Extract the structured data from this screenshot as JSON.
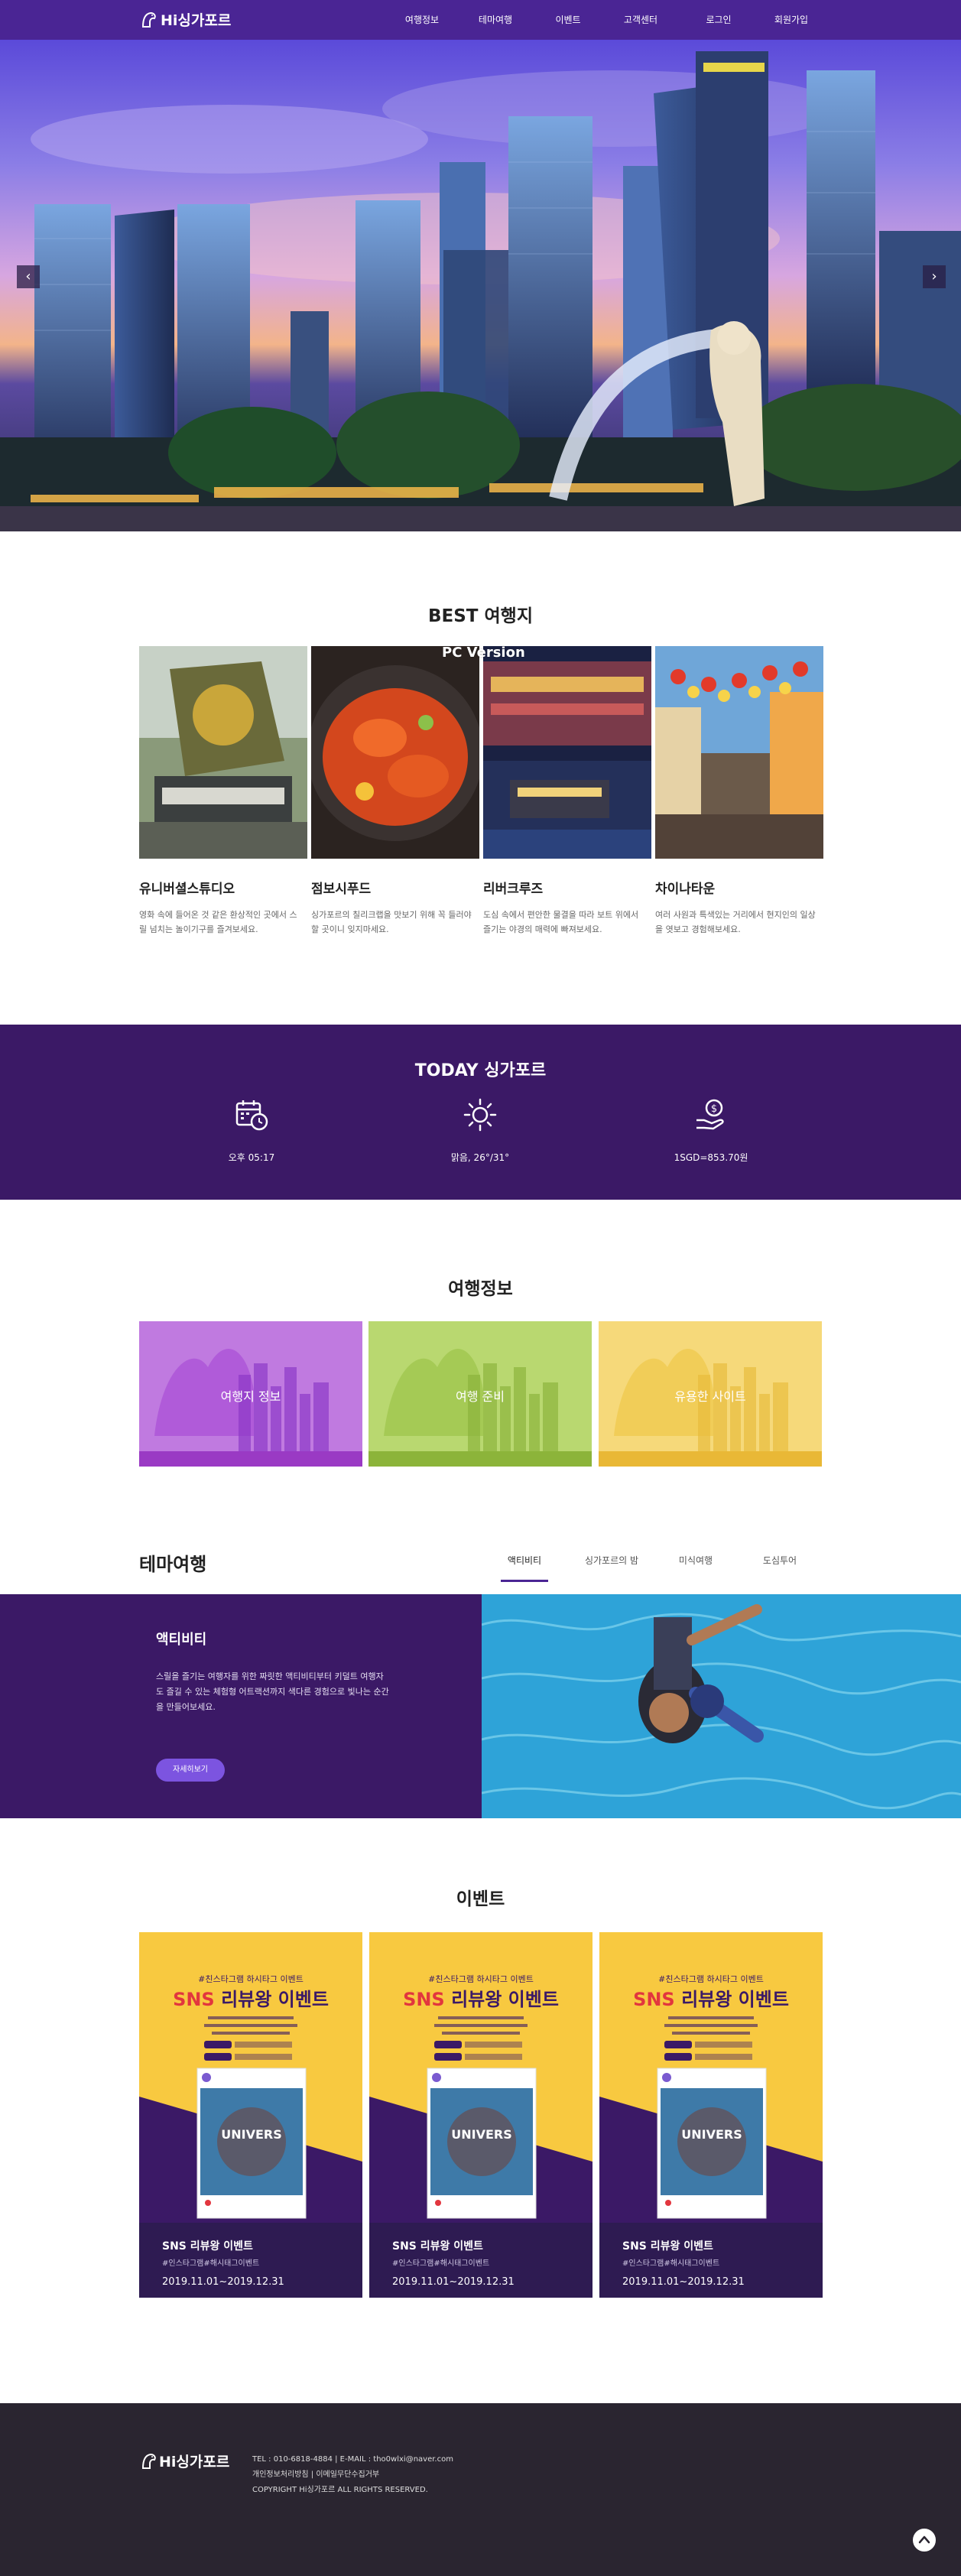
{
  "header": {
    "logo_text": "Hi싱가포르",
    "nav": [
      "여행정보",
      "테마여행",
      "이벤트",
      "고객센터",
      "로그인",
      "회원가입"
    ]
  },
  "hero": {
    "prev_icon": "chevron-left-icon",
    "next_icon": "chevron-right-icon",
    "prev_label": "‹",
    "next_label": "›"
  },
  "best": {
    "title": "BEST 여행지",
    "overlay": "PC Version",
    "items": [
      {
        "name": "유니버셜스튜디오",
        "desc": "영화 속에 들어온 것 같은 환상적인 곳에서 스릴 넘치는 놀이기구를 즐겨보세요."
      },
      {
        "name": "점보시푸드",
        "desc": "싱가포르의 칠리크랩을 맛보기 위해 꼭 들러야 할 곳이니 잊지마세요."
      },
      {
        "name": "리버크루즈",
        "desc": "도심 속에서 편안한 물결을 따라 보트 위에서 즐기는 야경의 매력에 빠져보세요."
      },
      {
        "name": "차이나타운",
        "desc": "여러 사원과 특색있는 거리에서 현지인의 일상을 엿보고 경험해보세요."
      }
    ]
  },
  "today": {
    "title": "TODAY 싱가포르",
    "items": [
      {
        "icon": "calendar-clock-icon",
        "label": "오후 05:17"
      },
      {
        "icon": "sun-icon",
        "label": "맑음, 26°/31°"
      },
      {
        "icon": "money-hand-icon",
        "label": "1SGD=853.70원"
      }
    ]
  },
  "travel_info": {
    "title": "여행정보",
    "items": [
      {
        "label": "여행지 정보",
        "color": "#b35bd8"
      },
      {
        "label": "여행 준비",
        "color": "#a9cc52"
      },
      {
        "label": "유용한 사이트",
        "color": "#f2cc5e"
      }
    ]
  },
  "theme": {
    "title": "테마여행",
    "tabs": [
      "액티비티",
      "싱가포르의 밤",
      "미식여행",
      "도심투어"
    ],
    "active_tab": "액티비티",
    "heading": "액티비티",
    "desc": "스릴을 즐기는 여행자를 위한 짜릿한 액티비티부터 키덜트 여행자도 즐길 수 있는 체험형 어트랙션까지 색다른 경험으로 빛나는 순간을 만들어보세요.",
    "button": "자세히보기"
  },
  "events": {
    "title": "이벤트",
    "poster_top": "#친스타그램 하시타그 이벤트",
    "poster_headline_red": "SNS",
    "poster_headline": "리뷰왕 이벤트",
    "items": [
      {
        "name": "SNS 리뷰왕 이벤트",
        "tag": "#인스타그램#해시태그이벤트",
        "date": "2019.11.01~2019.12.31"
      },
      {
        "name": "SNS 리뷰왕 이벤트",
        "tag": "#인스타그램#해시태그이벤트",
        "date": "2019.11.01~2019.12.31"
      },
      {
        "name": "SNS 리뷰왕 이벤트",
        "tag": "#인스타그램#해시태그이벤트",
        "date": "2019.11.01~2019.12.31"
      }
    ]
  },
  "footer": {
    "logo_text": "Hi싱가포르",
    "lines": [
      "TEL : 010-6818-4884 | E-MAIL : tho0wlxi@naver.com",
      "개인정보처리방침 | 이메일무단수집거부",
      "COPYRIGHT Hi싱가포르 ALL RIGHTS RESERVED."
    ],
    "top_icon": "arrow-up-icon"
  },
  "colors": {
    "primary": "#4a2594",
    "today_bg": "#3b1966",
    "footer_bg": "#2a2530",
    "accent_button": "#7c54e0",
    "event_yellow": "#f8c940"
  }
}
